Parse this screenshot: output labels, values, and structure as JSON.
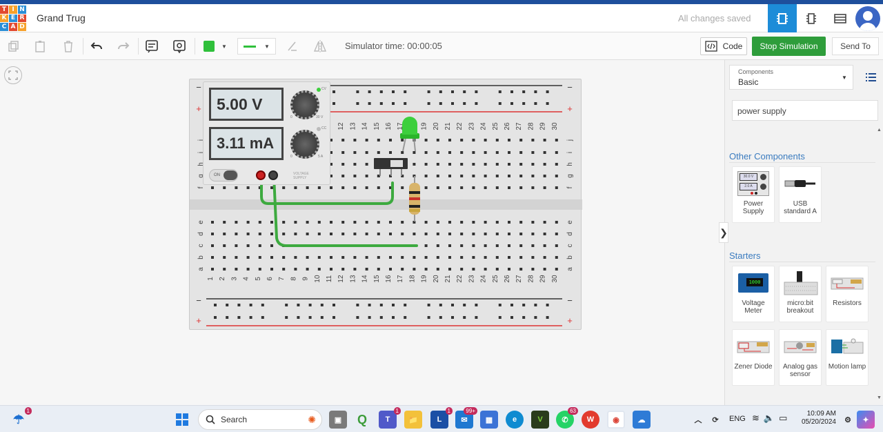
{
  "app": {
    "title": "Grand Trug",
    "status": "All changes saved",
    "logo_letters": [
      "T",
      "I",
      "N",
      "K",
      "E",
      "R",
      "C",
      "A",
      "D"
    ]
  },
  "toolbar": {
    "sim_time": "Simulator time: 00:00:05",
    "code_label": "Code",
    "stop_label": "Stop Simulation",
    "send_label": "Send To"
  },
  "power_supply": {
    "voltage": "5.00 V",
    "current": "3.11 mA",
    "on_label": "ON",
    "voltage_max": "30 V",
    "current_max": "5 A",
    "zero": "0",
    "cv": "CV",
    "cc": "CC",
    "brand": "VOLTAGE SUPPLY"
  },
  "breadboard": {
    "columns_top": [
      "12",
      "13",
      "14",
      "15",
      "16",
      "17",
      "18",
      "19",
      "20",
      "21",
      "22",
      "23",
      "24",
      "25",
      "26",
      "27",
      "28",
      "29",
      "30"
    ],
    "columns_bottom": [
      "1",
      "2",
      "3",
      "4",
      "5",
      "6",
      "7",
      "8",
      "9",
      "10",
      "11",
      "12",
      "13",
      "14",
      "15",
      "16",
      "17",
      "18",
      "19",
      "20",
      "21",
      "22",
      "23",
      "24",
      "25",
      "26",
      "27",
      "28",
      "29",
      "30"
    ],
    "rows_upper": [
      "j",
      "i",
      "h",
      "g",
      "f"
    ],
    "rows_lower": [
      "e",
      "d",
      "c",
      "b",
      "a"
    ],
    "minus": "−",
    "plus": "+"
  },
  "panel": {
    "components_label": "Components",
    "components_value": "Basic",
    "search_value": "power supply",
    "other_title": "Other Components",
    "other_items": [
      {
        "label": "Power Supply",
        "icon": "power-supply-icon",
        "screen1": "30.0 V",
        "screen2": "2.0 A"
      },
      {
        "label": "USB standard A",
        "icon": "usb-cable-icon"
      }
    ],
    "starters_title": "Starters",
    "starters": [
      {
        "label": "Voltage Meter",
        "icon": "voltage-meter-icon",
        "lcd": "1000"
      },
      {
        "label": "micro:bit breakout",
        "icon": "microbit-icon"
      },
      {
        "label": "Resistors",
        "icon": "resistors-icon"
      },
      {
        "label": "Zener Diode",
        "icon": "zener-diode-icon"
      },
      {
        "label": "Analog gas sensor",
        "icon": "gas-sensor-icon"
      },
      {
        "label": "Motion lamp",
        "icon": "motion-lamp-icon"
      }
    ]
  },
  "taskbar": {
    "search_label": "Search",
    "weather_badge": "1",
    "teams_badge": "1",
    "outlook_badge": "1",
    "mail_badge": "99+",
    "whatsapp_badge": "63",
    "lang": "ENG",
    "time": "10:09 AM",
    "date": "05/20/2024"
  },
  "colors": {
    "accent": "#1d8cd8",
    "stop_green": "#2e9d3b",
    "wire_green": "#3daa3f",
    "led_green": "#3ccf3c"
  }
}
